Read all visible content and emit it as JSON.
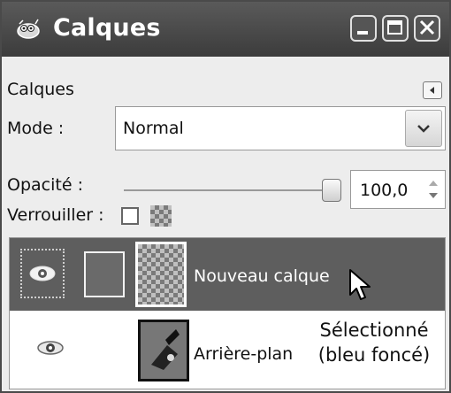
{
  "window": {
    "title": "Calques",
    "icon": "gimp-wilber-icon",
    "buttons": [
      "minimize-icon",
      "maximize-icon",
      "close-icon"
    ]
  },
  "panel": {
    "title": "Calques",
    "menu_icon": "panel-menu-arrow-icon"
  },
  "mode": {
    "label": "Mode :",
    "value": "Normal"
  },
  "opacity": {
    "label": "Opacité :",
    "value": "100,0",
    "level": 1.0
  },
  "lock": {
    "label": "Verrouiller :",
    "pixels_checked": false,
    "alpha_icon": "checkerboard-icon"
  },
  "layers": [
    {
      "name": "Nouveau calque",
      "visible": true,
      "selected": true
    },
    {
      "name": "Arrière-plan",
      "visible": true,
      "selected": false
    }
  ],
  "annotation": {
    "line1": "Sélectionné",
    "line2": "(bleu foncé)"
  },
  "colors": {
    "titlebar": "#4a4a4a",
    "selected_row": "#5e5e5e"
  }
}
